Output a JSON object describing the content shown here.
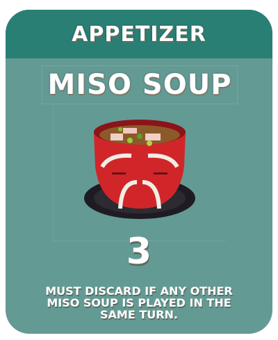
{
  "card": {
    "category": "APPETIZER",
    "name": "MISO SOUP",
    "points": "3",
    "rule": "MUST DISCARD IF ANY OTHER MISO SOUP IS PLAYED IN THE SAME TURN.",
    "image_icon": "miso-soup-bowl-icon",
    "colors": {
      "header": "#2a7f75",
      "body": "#649a94",
      "bowl": "#d0262a"
    }
  }
}
